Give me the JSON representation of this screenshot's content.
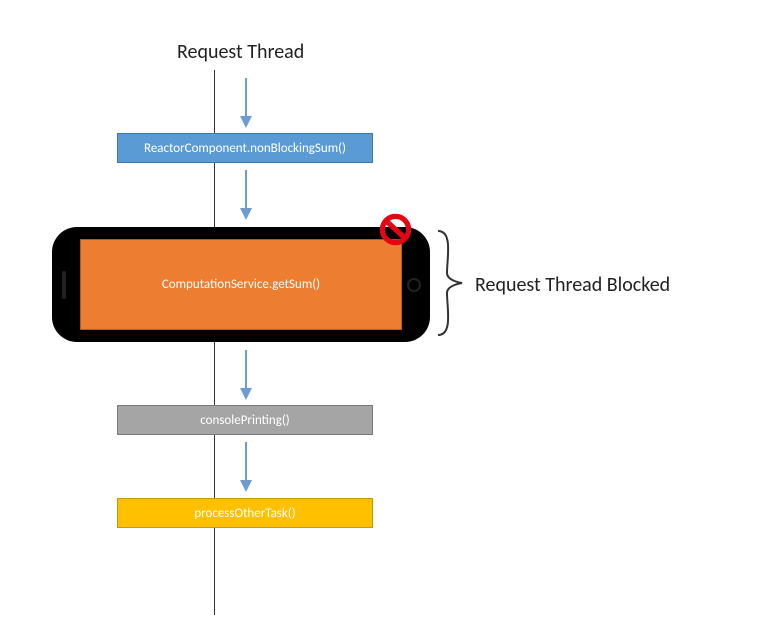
{
  "title": "Request Thread",
  "annotation": "Request Thread Blocked",
  "boxes": {
    "reactor": "ReactorComponent.nonBlockingSum()",
    "computation": "ComputationService.getSum()",
    "console": "consolePrinting()",
    "other": "processOtherTask()"
  },
  "icons": {
    "prohibit": "prohibit-icon",
    "brace": "curly-brace"
  },
  "colors": {
    "blue": "#5b9bd5",
    "orange": "#ed7d31",
    "gray": "#a5a5a5",
    "yellow": "#ffc000",
    "arrow": "#6f9bd1",
    "prohibit": "#e30613"
  }
}
